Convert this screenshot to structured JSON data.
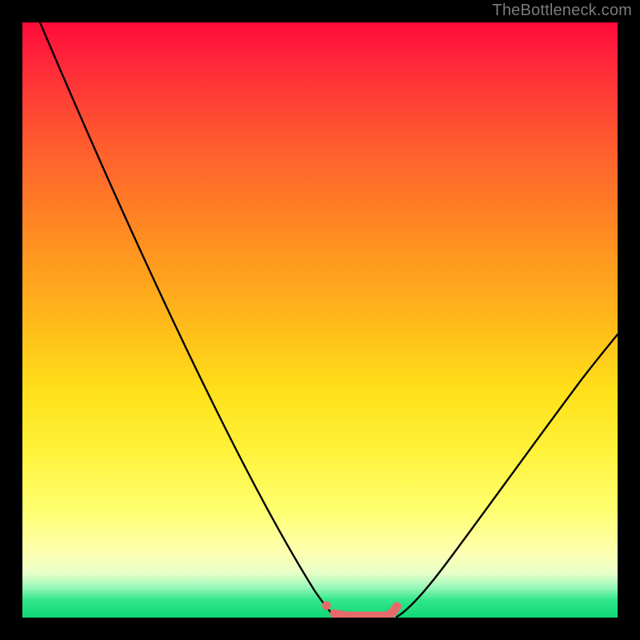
{
  "watermark": "TheBottleneck.com",
  "colors": {
    "background": "#000000",
    "curve": "#000000",
    "marker": "#e66a6a",
    "gradient_top": "#ff0a3a",
    "gradient_bottom": "#0fd877"
  },
  "chart_data": {
    "type": "line",
    "title": "",
    "xlabel": "",
    "ylabel": "",
    "xlim": [
      0,
      100
    ],
    "ylim": [
      0,
      100
    ],
    "series": [
      {
        "name": "left-curve",
        "x": [
          3,
          10,
          18,
          26,
          32,
          38,
          43,
          47,
          49.5,
          51
        ],
        "y": [
          100,
          82,
          64,
          46,
          33,
          21,
          11,
          4,
          1,
          0
        ]
      },
      {
        "name": "right-curve",
        "x": [
          62,
          64,
          68,
          74,
          82,
          90,
          100
        ],
        "y": [
          0,
          2,
          8,
          17,
          30,
          42,
          56
        ]
      }
    ],
    "markers": {
      "name": "minimum-band",
      "x": [
        51,
        53,
        55,
        57,
        59,
        60.5,
        61.5,
        62
      ],
      "y": [
        0.5,
        0,
        0,
        0,
        0,
        0.2,
        0.8,
        1.5
      ]
    },
    "marker_dot": {
      "x": 50.5,
      "y": 2.2
    }
  }
}
